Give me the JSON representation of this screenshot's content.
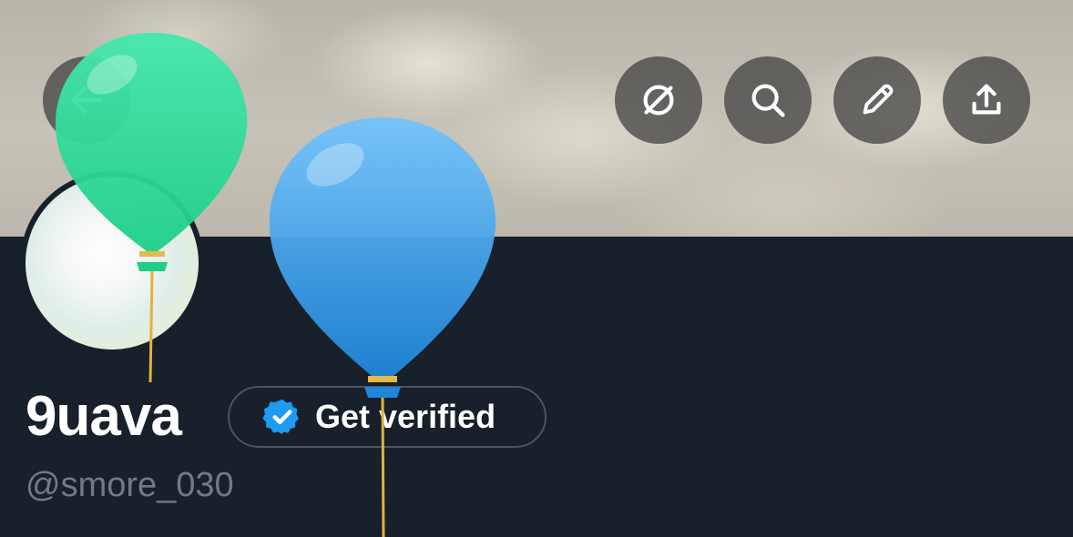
{
  "header": {
    "buttons": [
      {
        "name": "back",
        "icon": "back-arrow-icon"
      },
      {
        "name": "topics",
        "icon": "slashed-circle-icon"
      },
      {
        "name": "search",
        "icon": "search-icon"
      },
      {
        "name": "edit",
        "icon": "pencil-icon"
      },
      {
        "name": "share",
        "icon": "share-upload-icon"
      }
    ]
  },
  "profile": {
    "display_name": "9uava",
    "handle": "@smore_030",
    "verify_label": "Get verified",
    "verify_icon": "verified-badge-icon",
    "verify_color": "#1d9bf0"
  },
  "decorations": {
    "balloons": [
      {
        "color": "#2ed596",
        "icon": "green-balloon"
      },
      {
        "color": "#4aa8f2",
        "icon": "blue-balloon"
      }
    ]
  },
  "colors": {
    "background": "#17202b",
    "text_primary": "#ffffff",
    "text_secondary": "#717b86"
  }
}
